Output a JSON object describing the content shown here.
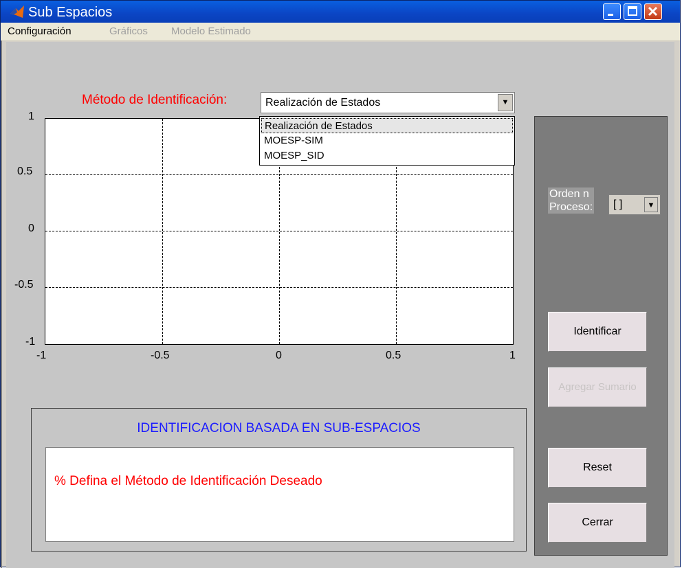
{
  "window": {
    "title": "Sub Espacios",
    "title_icon": "matlab-logo-icon"
  },
  "menu": {
    "items": [
      {
        "label": "Configuración",
        "enabled": true
      },
      {
        "label": "Gráficos",
        "enabled": false
      },
      {
        "label": "Modelo Estimado",
        "enabled": false
      }
    ]
  },
  "method": {
    "label": "Método de Identificación:",
    "selected": "Realización de Estados",
    "options": [
      "Realización de Estados",
      "MOESP-SIM",
      "MOESP_SID"
    ]
  },
  "chart_data": {
    "type": "line",
    "series": [],
    "title": "",
    "xlabel": "",
    "ylabel": "",
    "xlim": [
      -1,
      1
    ],
    "ylim": [
      -1,
      1
    ],
    "xticks": [
      "-1",
      "-0.5",
      "0",
      "0.5",
      "1"
    ],
    "yticks": [
      "1",
      "0.5",
      "0",
      "-0.5",
      "-1"
    ],
    "grid": true
  },
  "side": {
    "orden_label_line1": "Orden n",
    "orden_label_line2": "Proceso:",
    "orden_value": "[ ]",
    "buttons": {
      "identificar": "Identificar",
      "agregar": "Agregar Sumario",
      "reset": "Reset",
      "cerrar": "Cerrar"
    }
  },
  "info": {
    "title": "IDENTIFICACION BASADA EN SUB-ESPACIOS",
    "message": "% Defina el Método de Identificación Deseado"
  },
  "colors": {
    "accent_red": "#ff0000",
    "title_blue": "#1c1cff",
    "side_panel": "#7c7c7c",
    "background": "#c6c6c6"
  }
}
